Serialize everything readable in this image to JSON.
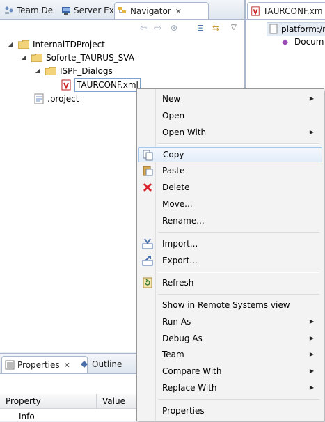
{
  "tabs": [
    {
      "label": "Team De"
    },
    {
      "label": "Server Ex"
    },
    {
      "label": "Navigator"
    }
  ],
  "tree": {
    "project": "InternalTDProject",
    "subfolder": "Soforte_TAURUS_SVA",
    "dialogs_folder": "ISPF_Dialogs",
    "selected_file": "TAURCONF.xml",
    "project_file": ".project"
  },
  "editor": {
    "tab_label": "TAURCONF.xm",
    "breadcrumb": "platform:/r",
    "outline_item": "Docum"
  },
  "properties": {
    "tabs": [
      {
        "label": "Properties"
      },
      {
        "label": "Outline"
      }
    ],
    "columns": [
      "Property",
      "Value"
    ],
    "rows": [
      "Info"
    ]
  },
  "menu": {
    "new": "New",
    "open": "Open",
    "open_with": "Open With",
    "copy": "Copy",
    "paste": "Paste",
    "delete": "Delete",
    "move": "Move...",
    "rename": "Rename...",
    "import": "Import...",
    "export": "Export...",
    "refresh": "Refresh",
    "show_remote": "Show in Remote Systems view",
    "run_as": "Run As",
    "debug_as": "Debug As",
    "team": "Team",
    "compare_with": "Compare With",
    "replace_with": "Replace With",
    "properties": "Properties"
  },
  "colors": {
    "accent": "#a8c8ed",
    "delete_red": "#d9232e",
    "folder_yellow": "#f3d37a"
  }
}
